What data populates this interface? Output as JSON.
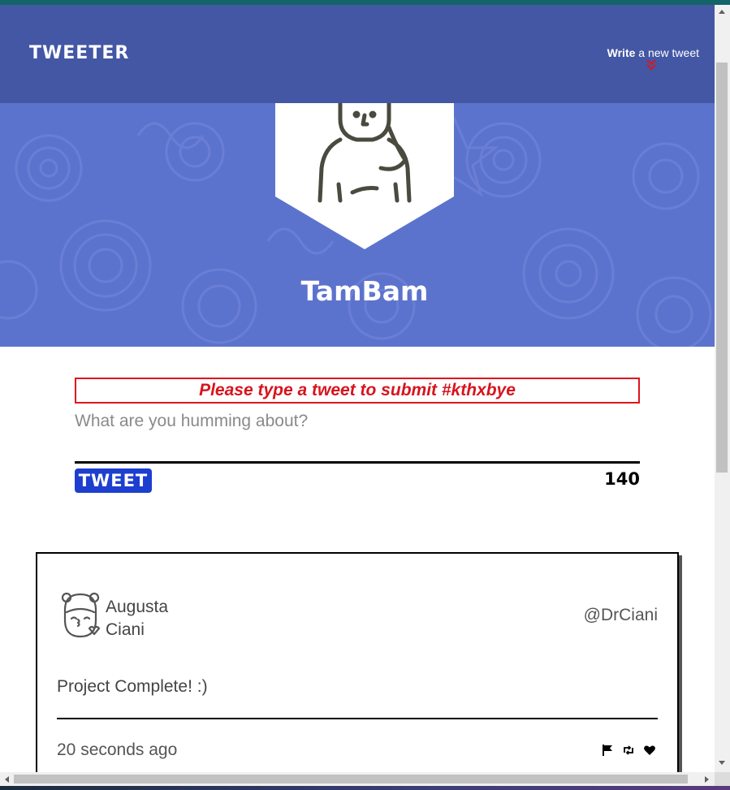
{
  "nav": {
    "brand": "TWEETER",
    "compose_bold": "Write",
    "compose_rest": " a new tweet"
  },
  "profile": {
    "username": "TamBam"
  },
  "compose": {
    "error": "Please type a tweet to submit #kthxbye",
    "placeholder": "What are you humming about?",
    "submit_label": "TWEET",
    "counter": "140"
  },
  "tweets": [
    {
      "author_first": "Augusta",
      "author_last": "Ciani",
      "handle": "@DrCiani",
      "content": "Project Complete! :)",
      "timestamp": "20 seconds ago",
      "actions": [
        "flag-icon",
        "retweet-icon",
        "heart-icon"
      ]
    }
  ],
  "colors": {
    "nav": "#4357a4",
    "hero": "#5c73cd",
    "error": "#e0141e",
    "button": "#1d3fcf"
  }
}
